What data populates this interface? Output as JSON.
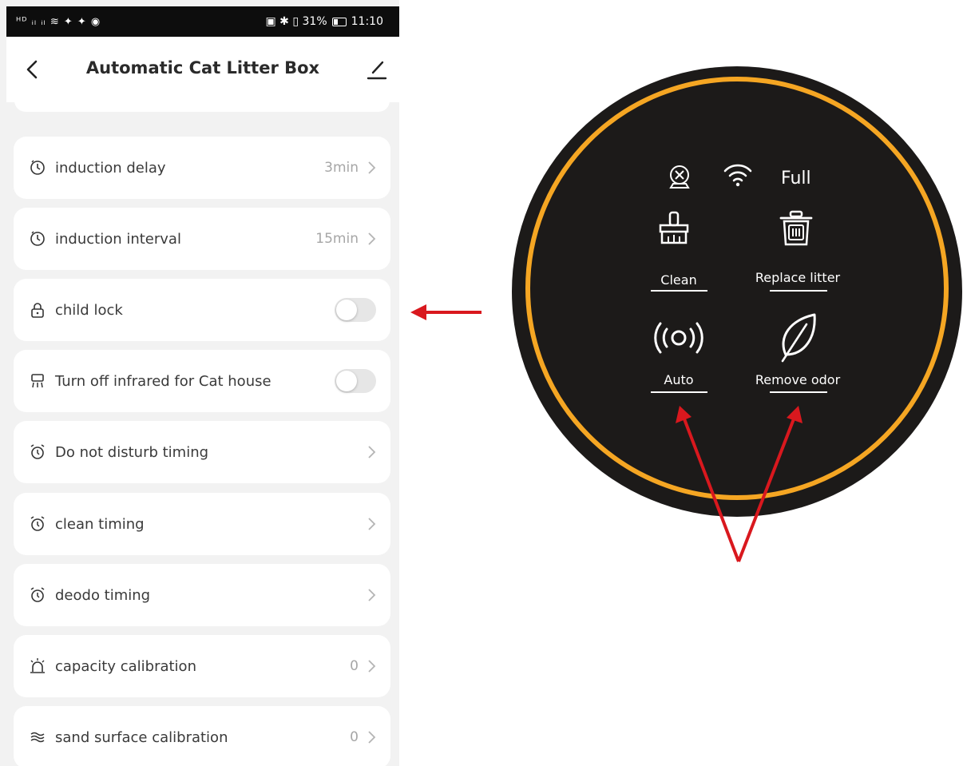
{
  "status_bar": {
    "left_text": "ᴴᴰ ᵢₗ ᵢₗ ≋ ✦ ✦ ◉",
    "right_text": "▣ ✱ ▯ 31%",
    "time": "11:10"
  },
  "header": {
    "title": "Automatic Cat Litter Box",
    "back_icon": "back-chevron-icon",
    "edit_icon": "pencil-icon"
  },
  "settings": [
    {
      "label": "induction delay",
      "value": "3min",
      "icon": "clock-icon",
      "control": "chevron"
    },
    {
      "label": "induction interval",
      "value": "15min",
      "icon": "clock-icon",
      "control": "chevron"
    },
    {
      "label": "child lock",
      "value": "",
      "icon": "lock-icon",
      "control": "toggle",
      "on": false
    },
    {
      "label": "Turn off infrared for Cat house",
      "value": "",
      "icon": "infrared-icon",
      "control": "toggle",
      "on": false
    },
    {
      "label": "Do not disturb timing",
      "value": "",
      "icon": "alarm-clock-icon",
      "control": "chevron"
    },
    {
      "label": "clean timing",
      "value": "",
      "icon": "alarm-clock-icon",
      "control": "chevron"
    },
    {
      "label": "deodo timing",
      "value": "",
      "icon": "alarm-clock-icon",
      "control": "chevron"
    },
    {
      "label": "capacity calibration",
      "value": "0",
      "icon": "siren-icon",
      "control": "chevron"
    },
    {
      "label": "sand surface calibration",
      "value": "0",
      "icon": "waves-icon",
      "control": "chevron"
    }
  ],
  "panel": {
    "status_full": "Full",
    "buttons": {
      "clean": "Clean",
      "replace_litter": "Replace litter",
      "auto": "Auto",
      "remove_odor": "Remove odor"
    },
    "colors": {
      "disc": "#1c1a19",
      "ring": "#f5a623"
    }
  },
  "annotation_colors": {
    "arrow": "#d9181e"
  }
}
